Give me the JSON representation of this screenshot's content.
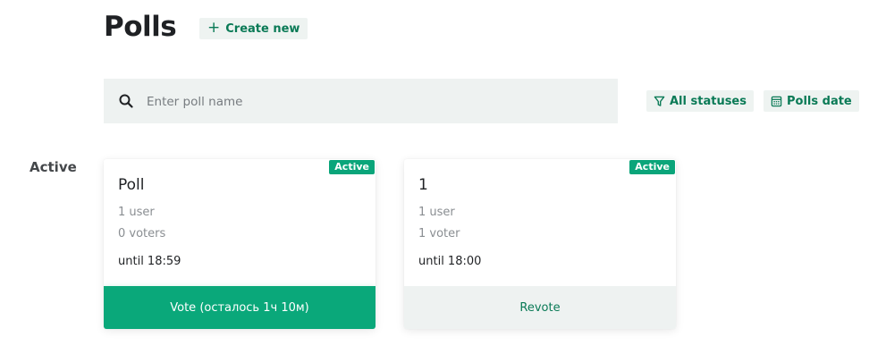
{
  "header": {
    "title": "Polls",
    "create_label": "Create new"
  },
  "search": {
    "placeholder": "Enter poll name",
    "value": ""
  },
  "filters": {
    "status_label": "All statuses",
    "date_label": "Polls date"
  },
  "sections": [
    {
      "label": "Active",
      "polls": [
        {
          "name": "Poll",
          "badge": "Active",
          "users": "1 user",
          "voters": "0 voters",
          "deadline": "until 18:59",
          "action": "Vote (осталось 1ч 10м)"
        },
        {
          "name": "1",
          "badge": "Active",
          "users": "1 user",
          "voters": "1 voter",
          "deadline": "until 18:00",
          "action": "Revote"
        }
      ]
    }
  ],
  "colors": {
    "accent": "#0aa87a",
    "accent_text": "#0a7a56",
    "muted_bg": "#eef2f1"
  },
  "icons": [
    "plus-icon",
    "search-icon",
    "filter-icon",
    "calendar-icon"
  ]
}
